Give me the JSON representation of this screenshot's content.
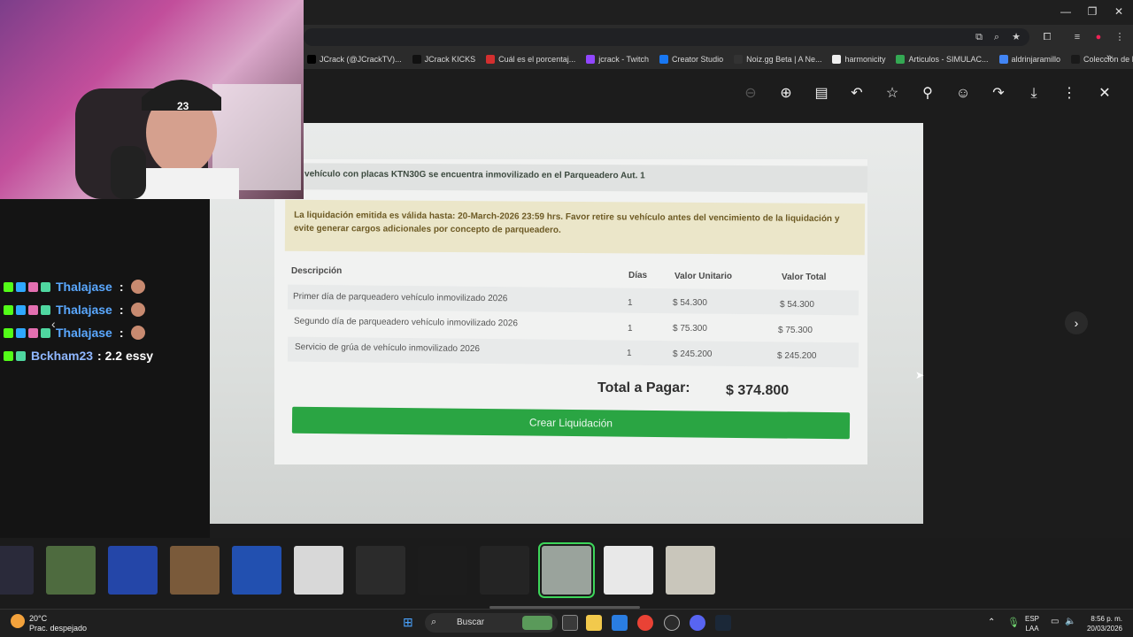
{
  "bookmarks": [
    {
      "label": "JCrack (@JCrackTV)...",
      "color": "#000000"
    },
    {
      "label": "JCrack KICKS",
      "color": "#111111"
    },
    {
      "label": "Cuál es el porcentaj...",
      "color": "#d32f2f"
    },
    {
      "label": "jcrack - Twitch",
      "color": "#9146ff"
    },
    {
      "label": "Creator Studio",
      "color": "#1877f2"
    },
    {
      "label": "Noiz.gg Beta | A Ne...",
      "color": "#333333"
    },
    {
      "label": "harmonicity",
      "color": "#eeeeee"
    },
    {
      "label": "Articulos - SIMULAC...",
      "color": "#34a853"
    },
    {
      "label": "aldrinjaramillo",
      "color": "#4285f4"
    },
    {
      "label": "Colección de M_blei...",
      "color": "#1a1a1a"
    }
  ],
  "document": {
    "notice": "vehículo con placas KTN30G se encuentra inmovilizado en el Parqueadero Aut. 1",
    "warning": "La liquidación emitida es válida hasta: 20-March-2026 23:59 hrs. Favor retire su vehículo antes del vencimiento de la liquidación y evite generar cargos adicionales por concepto de parqueadero.",
    "headers": {
      "descripcion": "Descripción",
      "dias": "Días",
      "unitario": "Valor Unitario",
      "total": "Valor Total"
    },
    "rows": [
      {
        "descripcion": "Primer día de parqueadero vehículo inmovilizado 2026",
        "dias": "1",
        "unitario": "$ 54.300",
        "total": "$ 54.300"
      },
      {
        "descripcion": "Segundo día de parqueadero vehículo inmovilizado 2026",
        "dias": "1",
        "unitario": "$ 75.300",
        "total": "$ 75.300"
      },
      {
        "descripcion": "Servicio de grúa de vehículo inmovilizado 2026",
        "dias": "1",
        "unitario": "$ 245.200",
        "total": "$ 245.200"
      }
    ],
    "total_label": "Total a Pagar:",
    "total_value": "$ 374.800",
    "button": "Crear Liquidación"
  },
  "chat": [
    {
      "user": "Thalajase",
      "sep": ":"
    },
    {
      "user": "Thalajase",
      "sep": ":"
    },
    {
      "user": "Thalajase",
      "sep": ":"
    },
    {
      "user": "Bckham23",
      "message": ": 2.2 essy"
    }
  ],
  "webcam": {
    "cap_text": "23"
  },
  "taskbar": {
    "weather_temp": "20°C",
    "weather_desc": "Prac. despejado",
    "search": "Buscar",
    "lang1": "ESP",
    "lang2": "LAA",
    "time": "8:56 p. m.",
    "date": "20/03/2026"
  },
  "thumbnails": [
    {
      "color": "#2a2a3a"
    },
    {
      "color": "#4e6b3f"
    },
    {
      "color": "#2446a8"
    },
    {
      "color": "#7a5a3a"
    },
    {
      "color": "#2250b0"
    },
    {
      "color": "#d8d8d8"
    },
    {
      "color": "#2b2b2b"
    },
    {
      "color": "#1c1c1c"
    },
    {
      "color": "#242424"
    },
    {
      "color": "#9aa39c"
    },
    {
      "color": "#e8e8e8"
    },
    {
      "color": "#c9c6bb"
    }
  ]
}
